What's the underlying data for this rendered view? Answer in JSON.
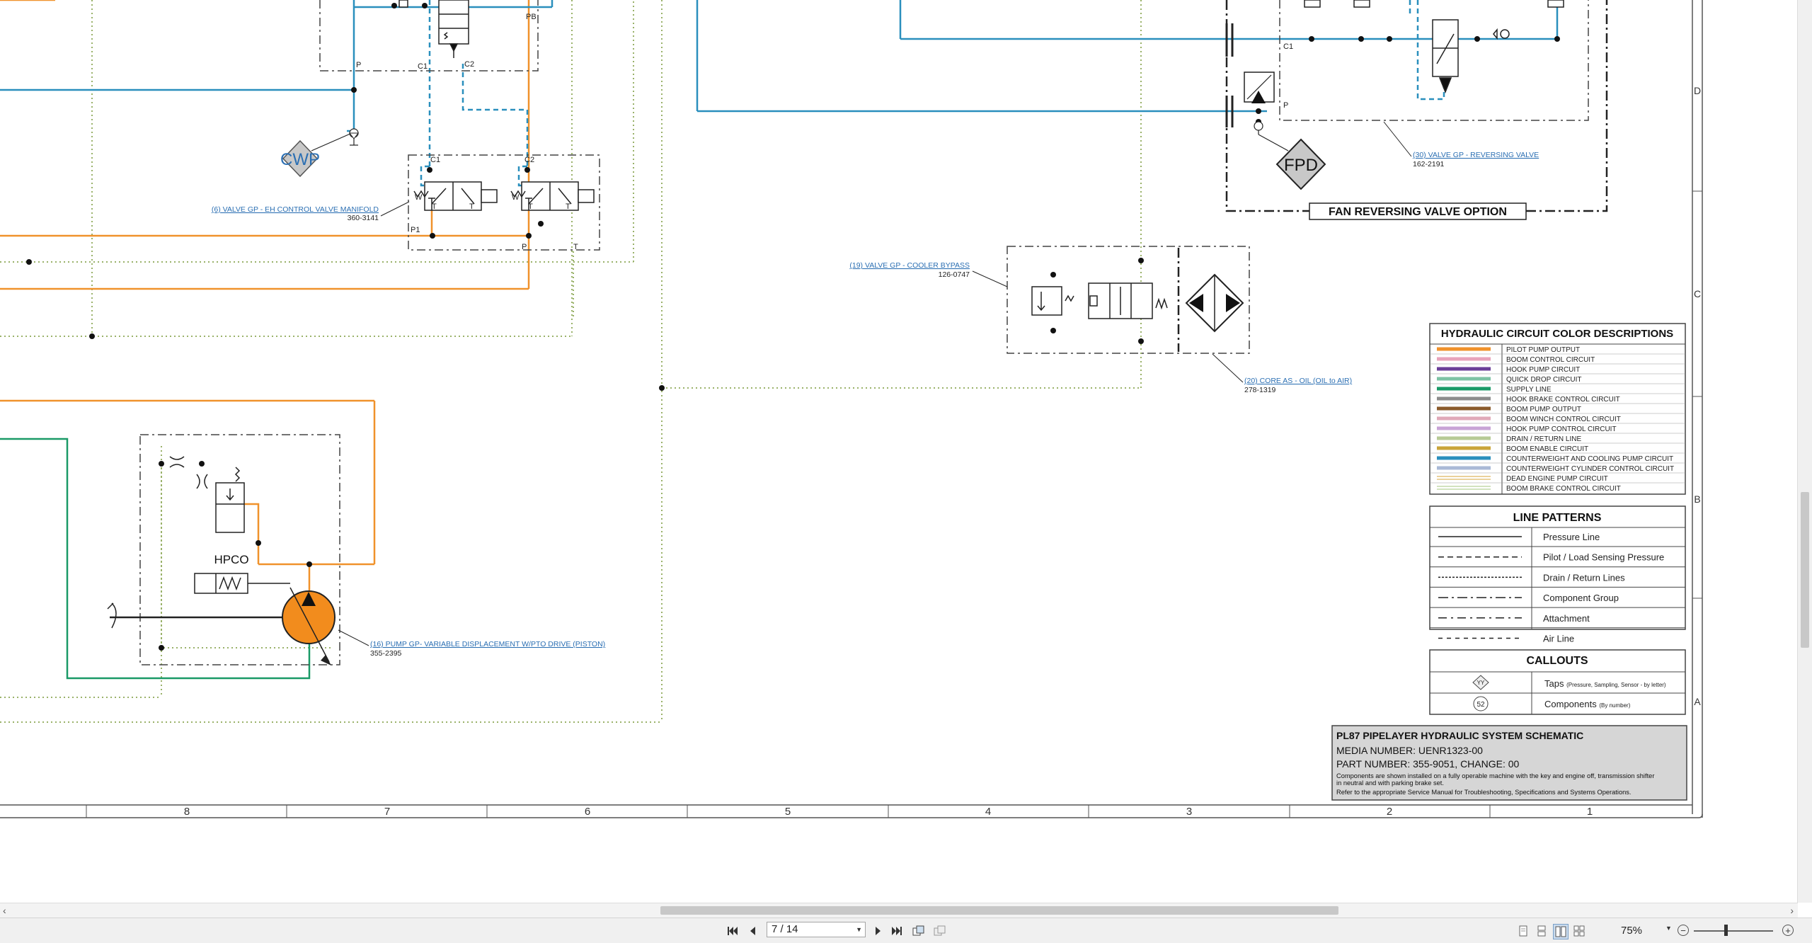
{
  "viewer": {
    "page_label": "7 / 14",
    "zoom_label": "75%"
  },
  "schematic": {
    "components": {
      "eh_valve_label": "(6) VALVE GP - EH CONTROL VALVE MANIFOLD",
      "eh_valve_part": "360-3141",
      "cooler_bypass_label": "(19) VALVE GP - COOLER BYPASS",
      "cooler_bypass_part": "126-0747",
      "core_label": "(20) CORE AS - OIL (OIL to AIR)",
      "core_part": "278-1319",
      "pump_label": "(16) PUMP GP- VARIABLE DISPLACEMENT W/PTO DRIVE (PISTON)",
      "pump_part": "355-2395",
      "reversing_valve_label": "(30) VALVE GP - REVERSING VALVE",
      "reversing_valve_part": "162-2191",
      "cwp_tag": "CWP",
      "fpd_tag": "FPD",
      "hpco_label": "HPCO",
      "fan_option_label": "FAN REVERSING VALVE OPTION"
    },
    "port_labels": {
      "p": "P",
      "pb": "PB",
      "c1": "C1",
      "c2": "C2",
      "w": "W",
      "t": "T",
      "p1": "P1"
    },
    "color_descriptions": {
      "title": "HYDRAULIC CIRCUIT COLOR DESCRIPTIONS",
      "items": [
        {
          "label": "PILOT PUMP OUTPUT",
          "color": "#f0922b",
          "style": "solid"
        },
        {
          "label": "BOOM CONTROL CIRCUIT",
          "color": "#e8a3bb",
          "style": "solid"
        },
        {
          "label": "HOOK PUMP CIRCUIT",
          "color": "#6a3e98",
          "style": "solid"
        },
        {
          "label": "QUICK DROP CIRCUIT",
          "color": "#7dc2a4",
          "style": "solid"
        },
        {
          "label": "SUPPLY LINE",
          "color": "#1a9a67",
          "style": "solid"
        },
        {
          "label": "HOOK BRAKE CONTROL CIRCUIT",
          "color": "#8c8c8c",
          "style": "solid"
        },
        {
          "label": "BOOM PUMP OUTPUT",
          "color": "#8a5a2b",
          "style": "solid"
        },
        {
          "label": "BOOM WINCH CONTROL CIRCUIT",
          "color": "#e0a9b8",
          "style": "solid"
        },
        {
          "label": "HOOK PUMP CONTROL CIRCUIT",
          "color": "#c8a4d6",
          "style": "solid"
        },
        {
          "label": "DRAIN / RETURN LINE",
          "color": "#b7ca95",
          "style": "solid"
        },
        {
          "label": "BOOM ENABLE CIRCUIT",
          "color": "#c9a43a",
          "style": "solid"
        },
        {
          "label": "COUNTERWEIGHT AND COOLING PUMP CIRCUIT",
          "color": "#2a8fbd",
          "style": "solid"
        },
        {
          "label": "COUNTERWEIGHT CYLINDER CONTROL CIRCUIT",
          "color": "#a9b9d6",
          "style": "solid"
        },
        {
          "label": "DEAD ENGINE PUMP CIRCUIT",
          "color": "#e3c27a",
          "style": "double"
        },
        {
          "label": "BOOM BRAKE CONTROL CIRCUIT",
          "color": "#c3d8a8",
          "style": "double"
        }
      ]
    },
    "line_patterns": {
      "title": "LINE PATTERNS",
      "items": [
        {
          "label": "Pressure Line",
          "dash": ""
        },
        {
          "label": "Pilot / Load Sensing Pressure",
          "dash": "8,5"
        },
        {
          "label": "Drain / Return Lines",
          "dash": "3,2"
        },
        {
          "label": "Component Group",
          "dash": "14,5,3,5"
        },
        {
          "label": "Attachment",
          "dash": "12,6,3,6"
        },
        {
          "label": "Air Line",
          "dash": "6,6"
        }
      ]
    },
    "callouts": {
      "title": "CALLOUTS",
      "taps_symbol": "YY",
      "taps_label": "Taps",
      "taps_note": "(Pressure, Sampling, Sensor - by letter)",
      "components_symbol": "52",
      "components_label": "Components",
      "components_note": "(By number)"
    },
    "title_block": {
      "title": "PL87 PIPELAYER HYDRAULIC SYSTEM SCHEMATIC",
      "media_number": "MEDIA NUMBER: UENR1323-00",
      "part_number": "PART NUMBER: 355-9051, CHANGE: 00",
      "note1": "Components are shown installed on a fully operable machine with the key and engine off, transmission shifter",
      "note2": "in neutral and with parking brake set.",
      "note3": "Refer to the appropriate Service Manual for Troubleshooting, Specifications and Systems Operations."
    },
    "grid_columns": [
      "8",
      "7",
      "6",
      "5",
      "4",
      "3",
      "2",
      "1"
    ],
    "grid_rows": [
      "D",
      "C",
      "B",
      "A"
    ]
  }
}
